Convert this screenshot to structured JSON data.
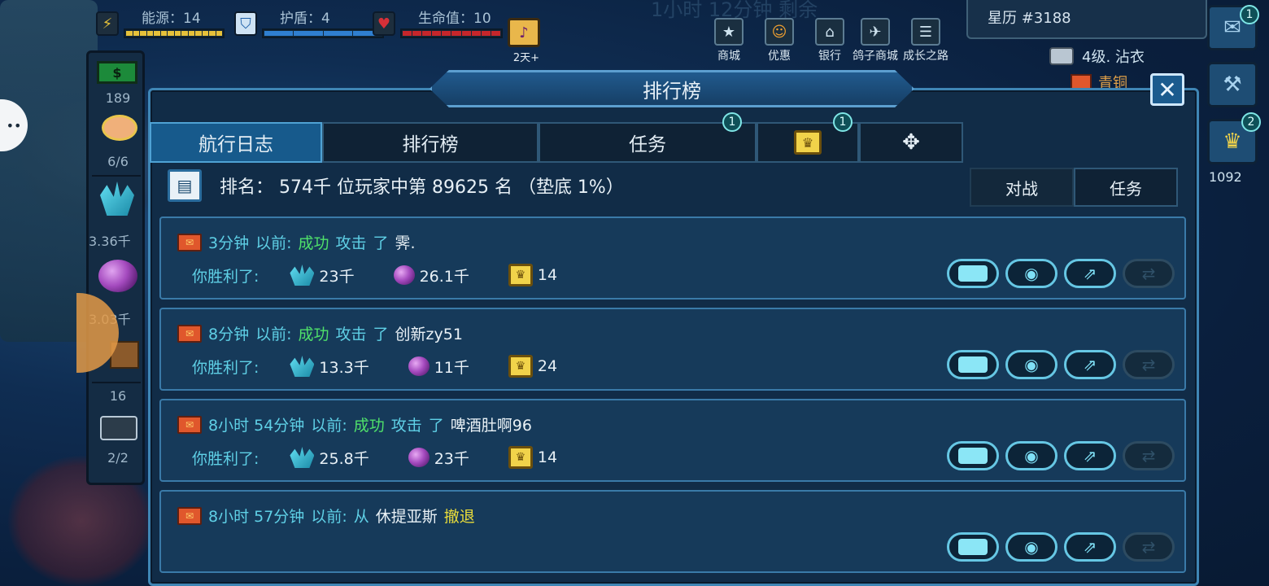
{
  "hud": {
    "energy_label": "能源：14",
    "shield_label": "护盾：4",
    "life_label": "生命值：10",
    "days": "2天+",
    "colors": {
      "energy": "#e6c13a",
      "shield": "#2f7fd0",
      "life": "#c6262b"
    }
  },
  "top_nav": [
    {
      "label": "商城",
      "icon": "star-badge-icon"
    },
    {
      "label": "优惠",
      "icon": "pumpkin-icon"
    },
    {
      "label": "银行",
      "icon": "bank-icon"
    },
    {
      "label": "鸽子商城",
      "icon": "pigeon-icon"
    },
    {
      "label": "成长之路",
      "icon": "document-icon"
    }
  ],
  "calendar": "星历 #3188",
  "faded_banner": "1小时 12分钟 剩余",
  "player": {
    "level": "4级. 沾衣",
    "rank": "青铜"
  },
  "right_panel": {
    "chat_badge": "1",
    "trophy_badge": "2",
    "trophy_count": "1092"
  },
  "sidebar": {
    "cash_symbol": "$",
    "cash_value": "189",
    "crew": "6/6",
    "minerals": "3.36千",
    "gas": "3.03千",
    "supplies": "16",
    "drones": "2/2"
  },
  "dialog": {
    "title": "排行榜",
    "close_symbol": "✕",
    "tabs": [
      {
        "label": "航行日志",
        "active": true
      },
      {
        "label": "排行榜",
        "active": false
      },
      {
        "label": "任务",
        "active": false,
        "badge": "1"
      },
      {
        "label": "",
        "icon": "trophy-icon",
        "badge": "1"
      },
      {
        "label": "",
        "icon": "dpad-icon"
      }
    ],
    "rank_text": "排名： 574千 位玩家中第 89625 名 （垫底 1%）",
    "filters": [
      {
        "label": "对战",
        "selected": true
      },
      {
        "label": "任务",
        "selected": false
      }
    ],
    "entries": [
      {
        "time": "3分钟",
        "ago": "以前:",
        "result": "成功",
        "verb": "攻击",
        "particle": "了",
        "target": "霁.",
        "won_label": "你胜利了:",
        "minerals": "23千",
        "gas": "26.1千",
        "trophies": "14"
      },
      {
        "time": "8分钟",
        "ago": "以前:",
        "result": "成功",
        "verb": "攻击",
        "particle": "了",
        "target": "创新zy51",
        "won_label": "你胜利了:",
        "minerals": "13.3千",
        "gas": "11千",
        "trophies": "24"
      },
      {
        "time": "8小时 54分钟",
        "ago": "以前:",
        "result": "成功",
        "verb": "攻击",
        "particle": "了",
        "target": "啤酒肚啊96",
        "won_label": "你胜利了:",
        "minerals": "25.8千",
        "gas": "23千",
        "trophies": "14"
      },
      {
        "time": "8小时 57分钟",
        "ago": "以前:",
        "from": "从",
        "target": "休提亚斯",
        "action": "撤退"
      }
    ]
  }
}
